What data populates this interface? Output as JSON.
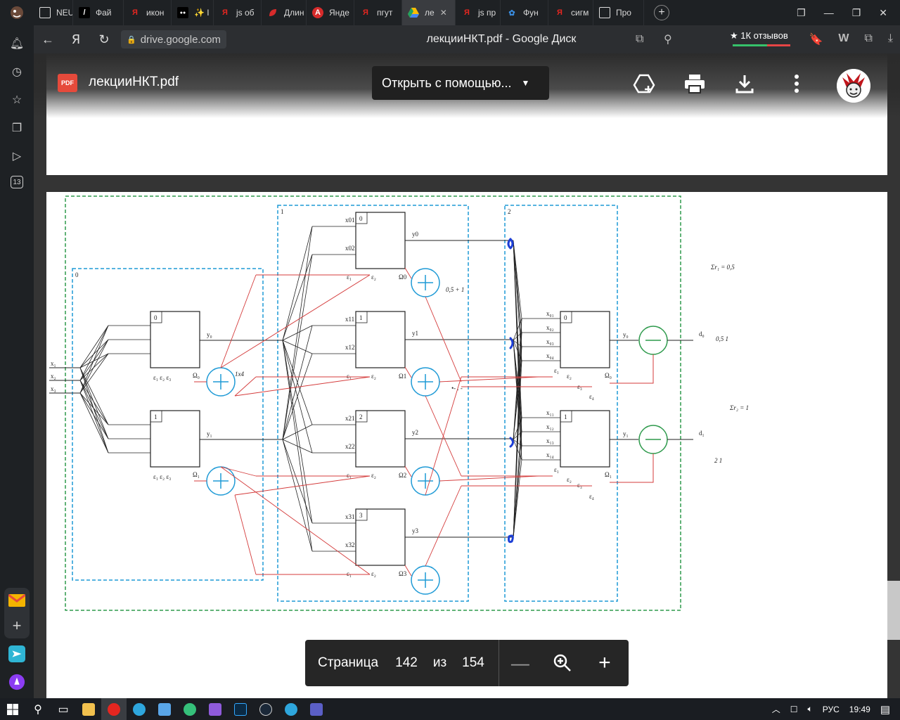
{
  "tabs": [
    {
      "label": "NEU",
      "icon": "doc-icon",
      "color": "#ffffff"
    },
    {
      "label": "Фай",
      "icon": "slash-icon",
      "color": "#000000"
    },
    {
      "label": "икон",
      "icon": "yandex-icon",
      "color": "#e52620"
    },
    {
      "label": "✨ I",
      "icon": "medium-icon",
      "color": "#000000"
    },
    {
      "label": "js об",
      "icon": "yandex-icon",
      "color": "#e52620"
    },
    {
      "label": "Длин",
      "icon": "leaf-icon",
      "color": "#d62b2b"
    },
    {
      "label": "Янде",
      "icon": "a-icon",
      "color": "#d62b2b"
    },
    {
      "label": "пгут",
      "icon": "yandex-icon",
      "color": "#e52620"
    },
    {
      "label": "ле",
      "icon": "drive-icon",
      "color": "#1ea362"
    },
    {
      "label": "js пр",
      "icon": "yandex-icon",
      "color": "#e52620"
    },
    {
      "label": "Фун",
      "icon": "gear-icon",
      "color": "#3a8de0"
    },
    {
      "label": "сигм",
      "icon": "yandex-icon",
      "color": "#e52620"
    },
    {
      "label": "Про",
      "icon": "doc-icon",
      "color": "#ffffff"
    }
  ],
  "address": {
    "url": "drive.google.com",
    "page_title": "лекцииНКТ.pdf - Google Диск",
    "reviews": "★ 1К отзывов"
  },
  "viewer": {
    "file_badge": "PDF",
    "file_name": "лекцииНКТ.pdf",
    "open_with": "Открыть с помощью..."
  },
  "pagenav": {
    "label": "Страница",
    "current": "142",
    "of": "из",
    "total": "154"
  },
  "sidebar": {
    "badge": "13"
  },
  "taskbar": {
    "lang": "РУС",
    "time": "19:49"
  },
  "diagram": {
    "block_labels": [
      "0",
      "1",
      "2"
    ],
    "inputs": [
      "x₁",
      "x₂",
      "x₃"
    ],
    "outputs": [
      "d₀",
      "d₁"
    ],
    "annotations": {
      "sum0": "0,5 + 1",
      "label_1x4": "1x4",
      "dots": "•- .  -",
      "eps1": "Σr₁ = 0,5",
      "val1": "0,5  1",
      "eps2": "Σr₂ = 1",
      "val2": "2   1"
    }
  }
}
